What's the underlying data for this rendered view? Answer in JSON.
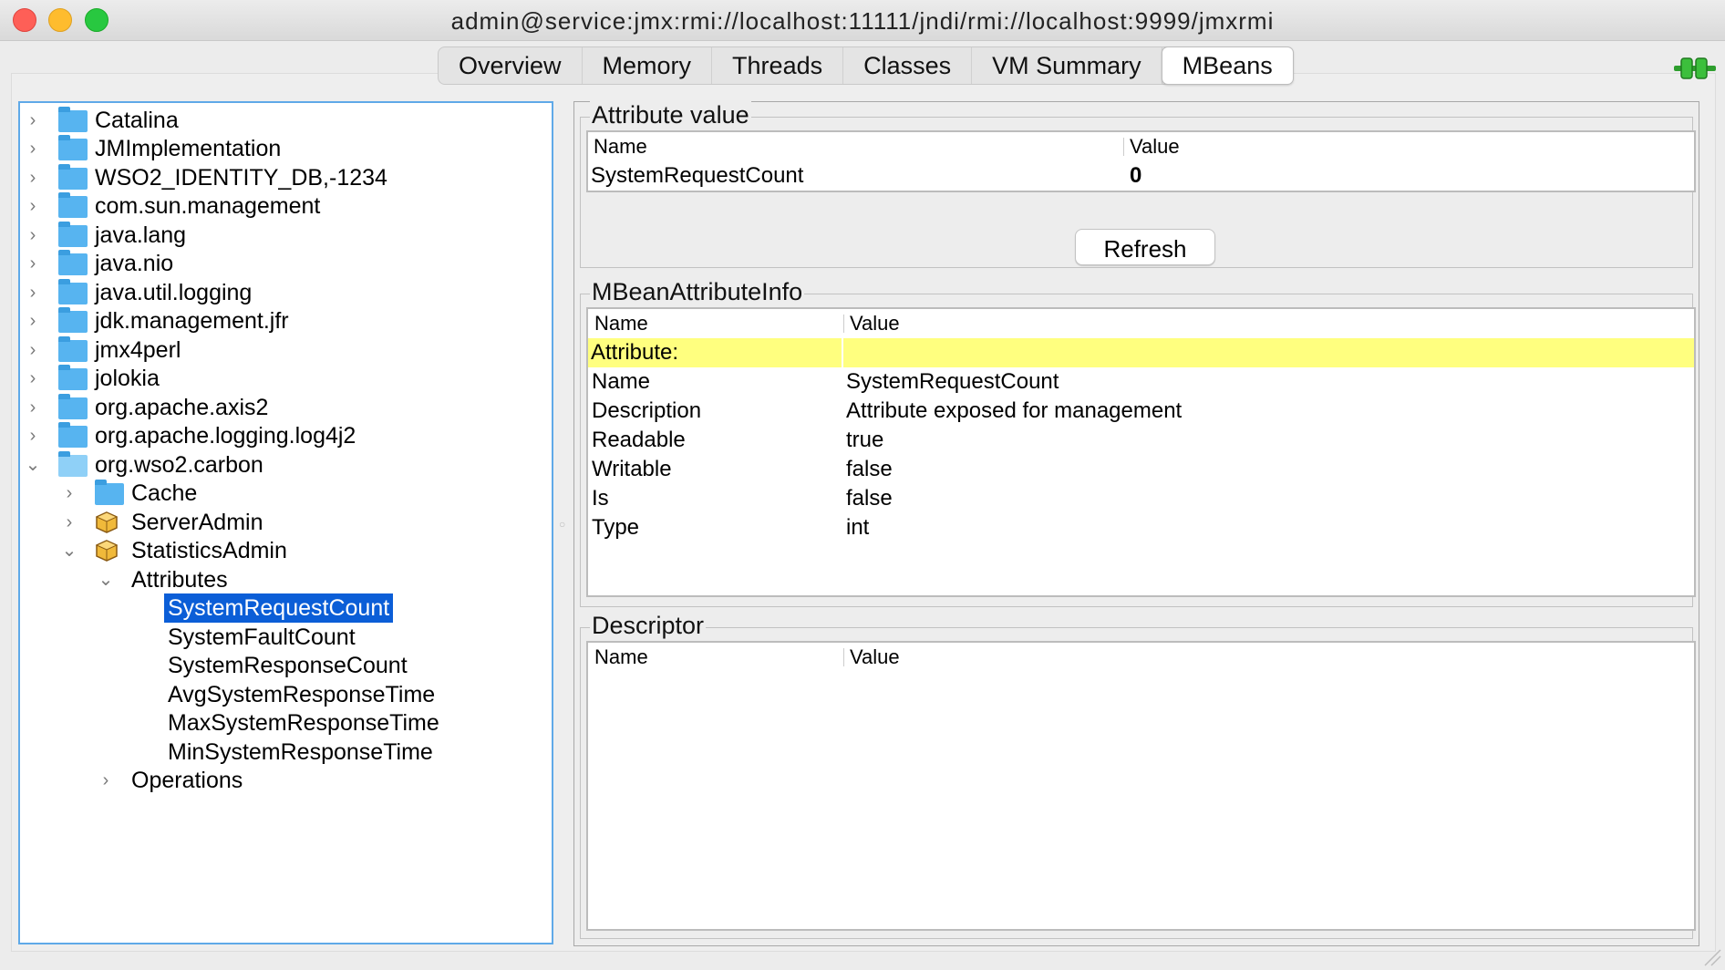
{
  "window": {
    "title": "admin@service:jmx:rmi://localhost:11111/jndi/rmi://localhost:9999/jmxrmi"
  },
  "tabs": [
    {
      "label": "Overview",
      "active": false
    },
    {
      "label": "Memory",
      "active": false
    },
    {
      "label": "Threads",
      "active": false
    },
    {
      "label": "Classes",
      "active": false
    },
    {
      "label": "VM Summary",
      "active": false
    },
    {
      "label": "MBeans",
      "active": true
    }
  ],
  "tree": {
    "nodes": [
      {
        "label": "Catalina",
        "icon": "folder-icon",
        "expanded": false
      },
      {
        "label": "JMImplementation",
        "icon": "folder-icon",
        "expanded": false
      },
      {
        "label": "WSO2_IDENTITY_DB,-1234",
        "icon": "folder-icon",
        "expanded": false
      },
      {
        "label": "com.sun.management",
        "icon": "folder-icon",
        "expanded": false
      },
      {
        "label": "java.lang",
        "icon": "folder-icon",
        "expanded": false
      },
      {
        "label": "java.nio",
        "icon": "folder-icon",
        "expanded": false
      },
      {
        "label": "java.util.logging",
        "icon": "folder-icon",
        "expanded": false
      },
      {
        "label": "jdk.management.jfr",
        "icon": "folder-icon",
        "expanded": false
      },
      {
        "label": "jmx4perl",
        "icon": "folder-icon",
        "expanded": false
      },
      {
        "label": "jolokia",
        "icon": "folder-icon",
        "expanded": false
      },
      {
        "label": "org.apache.axis2",
        "icon": "folder-icon",
        "expanded": false
      },
      {
        "label": "org.apache.logging.log4j2",
        "icon": "folder-icon",
        "expanded": false
      },
      {
        "label": "org.wso2.carbon",
        "icon": "folder-icon",
        "expanded": true
      },
      {
        "label": "Cache",
        "icon": "folder-icon",
        "expanded": false
      },
      {
        "label": "ServerAdmin",
        "icon": "mbean-icon",
        "expanded": false
      },
      {
        "label": "StatisticsAdmin",
        "icon": "mbean-icon",
        "expanded": true
      },
      {
        "label": "Attributes",
        "icon": "none",
        "expanded": true
      },
      {
        "label": "SystemRequestCount",
        "icon": "none",
        "selected": true
      },
      {
        "label": "SystemFaultCount",
        "icon": "none"
      },
      {
        "label": "SystemResponseCount",
        "icon": "none"
      },
      {
        "label": "AvgSystemResponseTime",
        "icon": "none"
      },
      {
        "label": "MaxSystemResponseTime",
        "icon": "none"
      },
      {
        "label": "MinSystemResponseTime",
        "icon": "none"
      },
      {
        "label": "Operations",
        "icon": "none",
        "expanded": false
      }
    ]
  },
  "attribute_value": {
    "legend": "Attribute value",
    "headers": {
      "name": "Name",
      "value": "Value"
    },
    "row": {
      "name": "SystemRequestCount",
      "value": "0"
    },
    "refresh_label": "Refresh"
  },
  "mbean_attribute_info": {
    "legend": "MBeanAttributeInfo",
    "headers": {
      "name": "Name",
      "value": "Value"
    },
    "rows": [
      {
        "name": "Attribute:",
        "value": ""
      },
      {
        "name": "Name",
        "value": "SystemRequestCount"
      },
      {
        "name": "Description",
        "value": "Attribute exposed for management"
      },
      {
        "name": "Readable",
        "value": "true"
      },
      {
        "name": "Writable",
        "value": "false"
      },
      {
        "name": "Is",
        "value": "false"
      },
      {
        "name": "Type",
        "value": "int"
      }
    ]
  },
  "descriptor": {
    "legend": "Descriptor",
    "headers": {
      "name": "Name",
      "value": "Value"
    }
  },
  "colors": {
    "selection": "#0b5ed7",
    "highlight_row": "#ffff7f",
    "tree_border": "#5fa9e8",
    "folder": "#57b4f0"
  }
}
